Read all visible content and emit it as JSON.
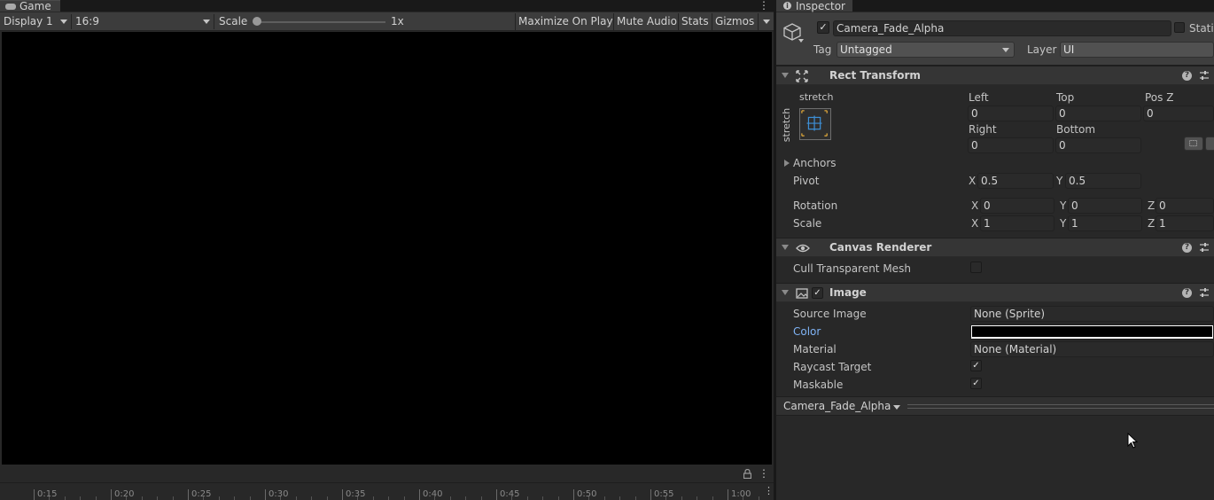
{
  "game": {
    "tab_label": "Game",
    "display": "Display 1",
    "aspect": "16:9",
    "scale_label": "Scale",
    "scale_value": "1x",
    "buttons": {
      "maximize": "Maximize On Play",
      "mute": "Mute Audio",
      "stats": "Stats",
      "gizmos": "Gizmos"
    },
    "timeline_ticks": [
      "0:15",
      "0:20",
      "0:25",
      "0:30",
      "0:35",
      "0:40",
      "0:45",
      "0:50",
      "0:55",
      "1:00"
    ]
  },
  "inspector": {
    "tab_label": "Inspector",
    "object_name": "Camera_Fade_Alpha",
    "static_label": "Stati",
    "tag_label": "Tag",
    "tag_value": "Untagged",
    "layer_label": "Layer",
    "layer_value": "UI",
    "rect_transform": {
      "title": "Rect Transform",
      "stretch_h": "stretch",
      "stretch_v": "stretch",
      "left_label": "Left",
      "left": "0",
      "top_label": "Top",
      "top": "0",
      "posz_label": "Pos Z",
      "posz": "0",
      "right_label": "Right",
      "right": "0",
      "bottom_label": "Bottom",
      "bottom": "0",
      "anchors_label": "Anchors",
      "pivot_label": "Pivot",
      "pivot_x": "0.5",
      "pivot_y": "0.5",
      "rotation_label": "Rotation",
      "rot_x": "0",
      "rot_y": "0",
      "rot_z": "0",
      "scale_label": "Scale",
      "scale_x": "1",
      "scale_y": "1",
      "scale_z": "1",
      "axis_x": "X",
      "axis_y": "Y",
      "axis_z": "Z"
    },
    "canvas_renderer": {
      "title": "Canvas Renderer",
      "cull_label": "Cull Transparent Mesh"
    },
    "image": {
      "title": "Image",
      "source_label": "Source Image",
      "source_value": "None (Sprite)",
      "color_label": "Color",
      "color_value": "#000000",
      "material_label": "Material",
      "material_value": "None (Material)",
      "raycast_label": "Raycast Target",
      "maskable_label": "Maskable"
    },
    "preview_name": "Camera_Fade_Alpha",
    "accent_color": "#7fb3f5"
  }
}
